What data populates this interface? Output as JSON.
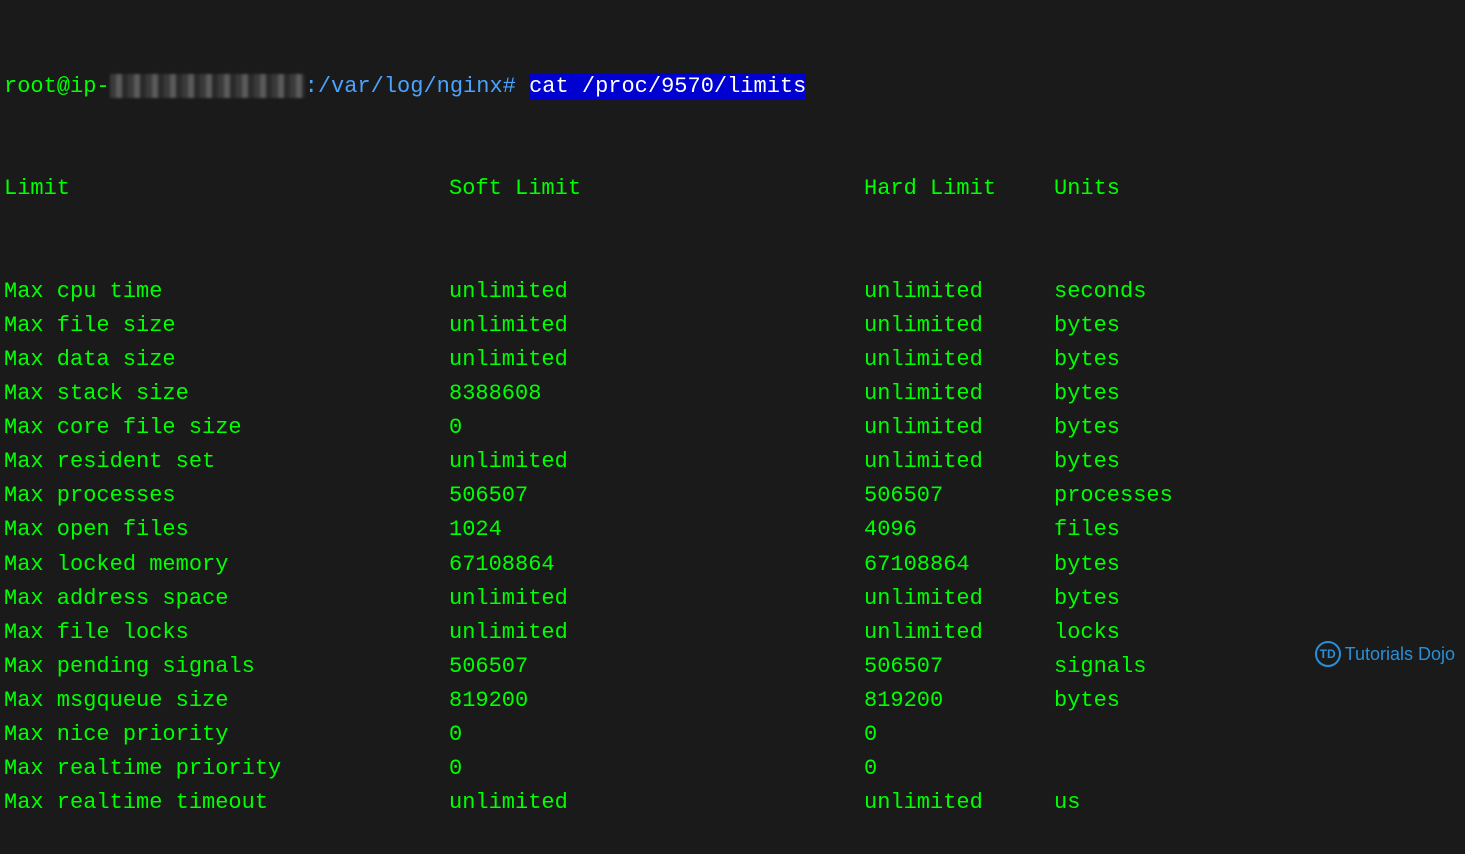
{
  "prompt": {
    "user": "root@ip-",
    "path": ":/var/log/nginx#",
    "command": "cat /proc/9570/limits"
  },
  "headers": {
    "limit": "Limit",
    "soft": "Soft Limit",
    "hard": "Hard Limit",
    "units": "Units"
  },
  "rows": [
    {
      "name": "Max cpu time",
      "soft": "unlimited",
      "hard": "unlimited",
      "units": "seconds"
    },
    {
      "name": "Max file size",
      "soft": "unlimited",
      "hard": "unlimited",
      "units": "bytes"
    },
    {
      "name": "Max data size",
      "soft": "unlimited",
      "hard": "unlimited",
      "units": "bytes"
    },
    {
      "name": "Max stack size",
      "soft": "8388608",
      "hard": "unlimited",
      "units": "bytes"
    },
    {
      "name": "Max core file size",
      "soft": "0",
      "hard": "unlimited",
      "units": "bytes"
    },
    {
      "name": "Max resident set",
      "soft": "unlimited",
      "hard": "unlimited",
      "units": "bytes"
    },
    {
      "name": "Max processes",
      "soft": "506507",
      "hard": "506507",
      "units": "processes"
    },
    {
      "name": "Max open files",
      "soft": "1024",
      "hard": "4096",
      "units": "files"
    },
    {
      "name": "Max locked memory",
      "soft": "67108864",
      "hard": "67108864",
      "units": "bytes"
    },
    {
      "name": "Max address space",
      "soft": "unlimited",
      "hard": "unlimited",
      "units": "bytes"
    },
    {
      "name": "Max file locks",
      "soft": "unlimited",
      "hard": "unlimited",
      "units": "locks"
    },
    {
      "name": "Max pending signals",
      "soft": "506507",
      "hard": "506507",
      "units": "signals"
    },
    {
      "name": "Max msgqueue size",
      "soft": "819200",
      "hard": "819200",
      "units": "bytes"
    },
    {
      "name": "Max nice priority",
      "soft": "0",
      "hard": "0",
      "units": ""
    },
    {
      "name": "Max realtime priority",
      "soft": "0",
      "hard": "0",
      "units": ""
    },
    {
      "name": "Max realtime timeout",
      "soft": "unlimited",
      "hard": "unlimited",
      "units": "us"
    }
  ],
  "watermark": {
    "badge": "TD",
    "text": "Tutorials Dojo"
  }
}
